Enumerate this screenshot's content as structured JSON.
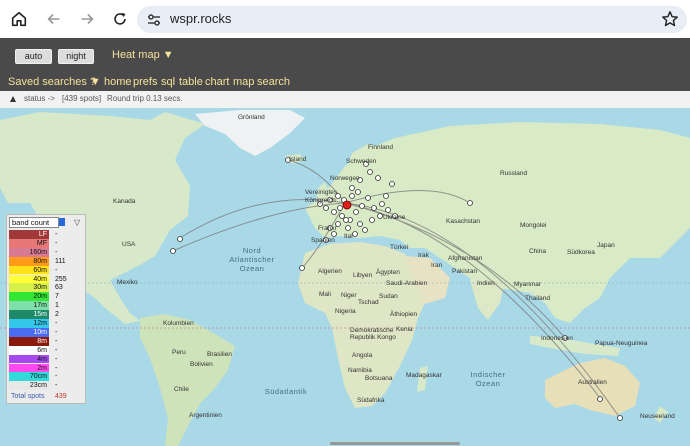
{
  "browser": {
    "url": "wspr.rocks",
    "icons": [
      "home-icon",
      "back-icon",
      "forward-icon",
      "reload-icon",
      "site-settings-icon",
      "bookmark-star-icon"
    ]
  },
  "toolbar": {
    "auto_label": "auto",
    "night_label": "night",
    "heatmap_label": "Heat map ▼"
  },
  "menu": {
    "saved_searches": "Saved searches ▼",
    "help": "?",
    "items": [
      "home",
      "prefs",
      "sql",
      "table",
      "chart",
      "map",
      "search"
    ]
  },
  "status": {
    "status_label": "status ->",
    "spots": "[439 spots]",
    "round_trip": "Round trip 0.13 secs."
  },
  "legend": {
    "header": "band count",
    "bands": [
      {
        "band": "LF",
        "count": "-",
        "color": "#a03a3a"
      },
      {
        "band": "MF",
        "count": "-",
        "color": "#e87878"
      },
      {
        "band": "160m",
        "count": "-",
        "color": "#d97a94"
      },
      {
        "band": "80m",
        "count": "111",
        "color": "#ff9a1a"
      },
      {
        "band": "60m",
        "count": "-",
        "color": "#ffe21a"
      },
      {
        "band": "40m",
        "count": "255",
        "color": "#ffff3a"
      },
      {
        "band": "30m",
        "count": "63",
        "color": "#d8f04a"
      },
      {
        "band": "20m",
        "count": "7",
        "color": "#33e633"
      },
      {
        "band": "17m",
        "count": "1",
        "color": "#7ee0a8"
      },
      {
        "band": "15m",
        "count": "2",
        "color": "#1f8a6a"
      },
      {
        "band": "12m",
        "count": "-",
        "color": "#33c8ea"
      },
      {
        "band": "10m",
        "count": "-",
        "color": "#4a6cf0"
      },
      {
        "band": "8m",
        "count": "-",
        "color": "#8a1a0a"
      },
      {
        "band": "6m",
        "count": "-",
        "color": "#ffffff"
      },
      {
        "band": "4m",
        "count": "-",
        "color": "#a64af0"
      },
      {
        "band": "2m",
        "count": "-",
        "color": "#ff4af0"
      },
      {
        "band": "70cm",
        "count": "-",
        "color": "#33dada"
      },
      {
        "band": "23cm",
        "count": "-",
        "color": "#e8e8e8"
      }
    ],
    "total_label": "Total spots",
    "total_value": "439"
  },
  "map": {
    "labels": {
      "gronland": "Grönland",
      "island": "Island",
      "finnland": "Finnland",
      "schweden": "Schweden",
      "norwegen": "Norwegen",
      "vereinigtes": "Vereinigtes",
      "konigreich": "Königreich",
      "russland": "Russland",
      "kanada": "Kanada",
      "usa": "USA",
      "mexiko": "Mexiko",
      "kasachstan": "Kasachstan",
      "mongolei": "Mongolei",
      "ukraine": "Ukraine",
      "spanien": "Spanien",
      "frankreich": "Frankr",
      "italien": "Ital",
      "turkei": "Türkei",
      "algerien": "Algerien",
      "libyen": "Libyen",
      "agypten": "Ägypten",
      "irak": "Irak",
      "iran": "Iran",
      "afghanistan": "Afghanistan",
      "pakistan": "Pakistan",
      "china": "China",
      "sudkorea": "Südkorea",
      "japan": "Japan",
      "saudi": "Saudi-Arabien",
      "indien": "Indien",
      "mali": "Mali",
      "niger": "Niger",
      "tschad": "Tschad",
      "sudan": "Sudan",
      "nigeria": "Nigeria",
      "athiopien": "Äthiopien",
      "kenia": "Kenia",
      "drk1": "Demokratische",
      "drk2": "Republik Kongo",
      "angola": "Angola",
      "namibia": "Namibia",
      "botsuana": "Botsuana",
      "madagaskar": "Madagaskar",
      "sudafrika": "Südafrika",
      "myanmar": "Myanmar",
      "thailand": "Thailand",
      "indonesien": "Indonesien",
      "papua": "Papua-Neuguinea",
      "australien": "Australien",
      "neuseeland": "Neuseeland",
      "kolumbien": "Kolumbien",
      "peru": "Peru",
      "bolivien": "Bolivien",
      "brasilien": "Brasilien",
      "chile": "Chile",
      "argentinien": "Argentinien"
    },
    "oceans": {
      "north_atlantic_1": "Nord",
      "north_atlantic_2": "Atlantischer",
      "north_atlantic_3": "Ozean",
      "south_atlantic": "Südatlantik",
      "indian_1": "Indischer",
      "indian_2": "Ozean"
    }
  }
}
